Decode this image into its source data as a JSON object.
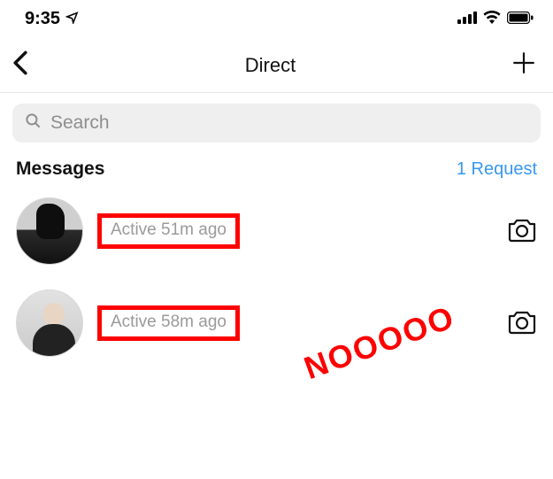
{
  "status_bar": {
    "time": "9:35"
  },
  "nav": {
    "title": "Direct"
  },
  "search": {
    "placeholder": "Search"
  },
  "section": {
    "messages": "Messages",
    "request": "1 Request"
  },
  "threads": [
    {
      "active_status": "Active 51m ago"
    },
    {
      "active_status": "Active 58m ago"
    }
  ],
  "annotation": {
    "text": "NOOOOO"
  }
}
